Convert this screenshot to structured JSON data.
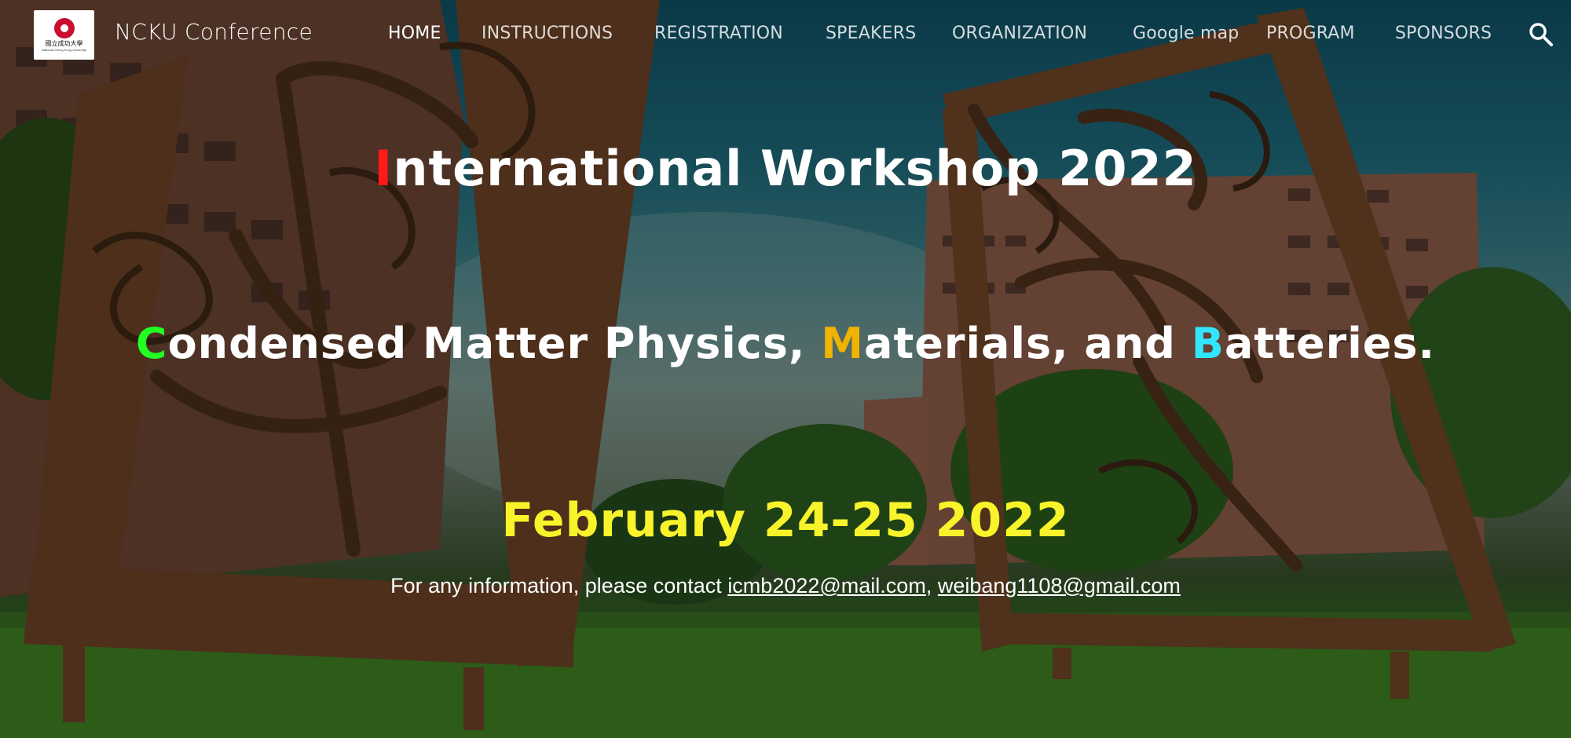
{
  "header": {
    "site_title": "NCKU Conference",
    "logo": {
      "text": "國立成功大學",
      "subtext": "National Cheng Kung University"
    }
  },
  "nav": {
    "items": [
      {
        "label": "HOME",
        "active": true
      },
      {
        "label": "INSTRUCTIONS"
      },
      {
        "label": "REGISTRATION"
      },
      {
        "label": "SPEAKERS"
      },
      {
        "label": "ORGANIZATION"
      },
      {
        "label": "Google map"
      },
      {
        "label": "PROGRAM"
      },
      {
        "label": "SPONSORS"
      }
    ],
    "search_icon": "search-icon"
  },
  "hero": {
    "title": {
      "initial": "I",
      "rest": "nternational Workshop 2022"
    },
    "subtitle": {
      "c_initial": "C",
      "c_rest": "ondensed Matter Physics, ",
      "m_initial": "M",
      "m_rest": "aterials, and ",
      "b_initial": "B",
      "b_rest": "atteries."
    },
    "date": "February 24-25 2022",
    "contact": {
      "prefix": "For any information, please contact ",
      "email1": " icmb2022@mail.com",
      "separator": ", ",
      "email2": "weibang1108@gmail.com"
    }
  },
  "colors": {
    "accent_I": "#ff1a1a",
    "accent_C": "#22ff22",
    "accent_M": "#f0b400",
    "accent_B": "#33e6ff",
    "date": "#f8f32a"
  }
}
